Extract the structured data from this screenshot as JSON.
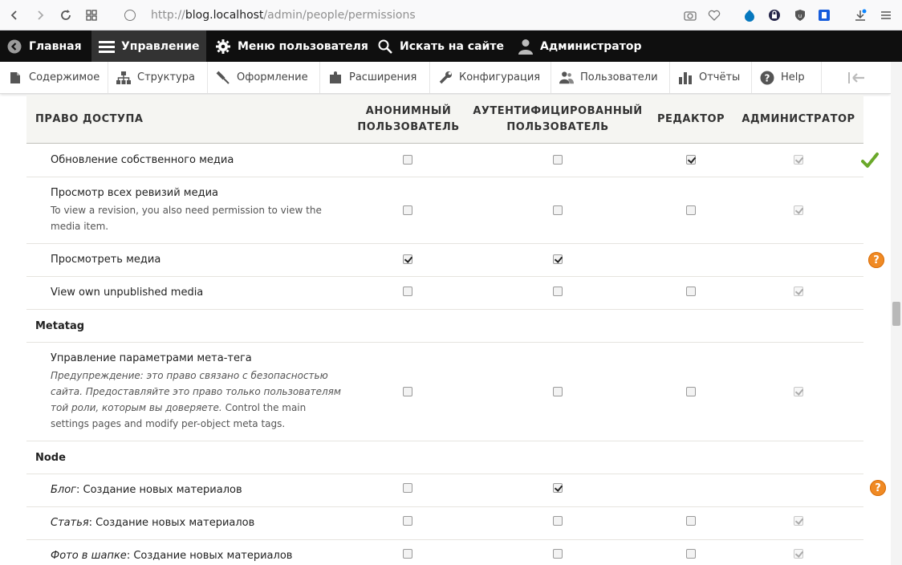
{
  "browser": {
    "url_scheme": "http://",
    "url_host": "blog.localhost",
    "url_path": "/admin/people/permissions"
  },
  "toolbar": {
    "items": [
      {
        "label": "Главная",
        "icon": "drupal-back-icon"
      },
      {
        "label": "Управление",
        "icon": "hamburger-icon"
      },
      {
        "label": "Меню пользователя",
        "icon": "gear-icon"
      },
      {
        "label": "Искать на сайте",
        "icon": "search-icon"
      },
      {
        "label": "Администратор",
        "icon": "user-icon"
      }
    ]
  },
  "tray": {
    "items": [
      {
        "label": "Содержимое",
        "icon": "file-icon"
      },
      {
        "label": "Структура",
        "icon": "structure-icon"
      },
      {
        "label": "Оформление",
        "icon": "paint-icon"
      },
      {
        "label": "Расширения",
        "icon": "puzzle-icon"
      },
      {
        "label": "Конфигурация",
        "icon": "wrench-icon"
      },
      {
        "label": "Пользователи",
        "icon": "people-icon"
      },
      {
        "label": "Отчёты",
        "icon": "chart-icon"
      },
      {
        "label": "Help",
        "icon": "help-icon"
      }
    ]
  },
  "table": {
    "headers": {
      "permission": "ПРАВО ДОСТУПА",
      "anon_line1": "АНОНИМНЫЙ",
      "anon_line2": "ПОЛЬЗОВАТЕЛЬ",
      "auth_line1": "АУТЕНТИФИЦИРОВАННЫЙ",
      "auth_line2": "ПОЛЬЗОВАТЕЛЬ",
      "editor": "РЕДАКТОР",
      "admin": "АДМИНИСТРАТОР"
    },
    "rows": [
      {
        "title": "Обновление собственного медиа"
      },
      {
        "title": "Просмотр всех ревизий медиа",
        "desc_line1": "To view a revision, you also need permission to view the",
        "desc_line2": "media item."
      },
      {
        "title": "Просмотреть медиа"
      },
      {
        "title": "View own unpublished media"
      },
      {
        "group": "Metatag"
      },
      {
        "title": "Управление параметрами мета-тега",
        "desc_line1": "Предупреждение: это право связано с безопасностью",
        "desc_line2": "сайта. Предоставляйте это право только пользователям",
        "desc_line3": "той роли, которым вы доверяете.",
        "desc_line3b": " Control the main",
        "desc_line4": "settings pages and modify per-object meta tags."
      },
      {
        "group": "Node"
      },
      {
        "title_em": "Блог",
        "title_rest": ": Создание новых материалов"
      },
      {
        "title_em": "Статья",
        "title_rest": ": Создание новых материалов"
      },
      {
        "title_em": "Фото в шапке",
        "title_rest": ": Создание новых материалов"
      }
    ]
  },
  "side_icons": [
    "checkmark-icon",
    "help-icon",
    "help-icon"
  ]
}
